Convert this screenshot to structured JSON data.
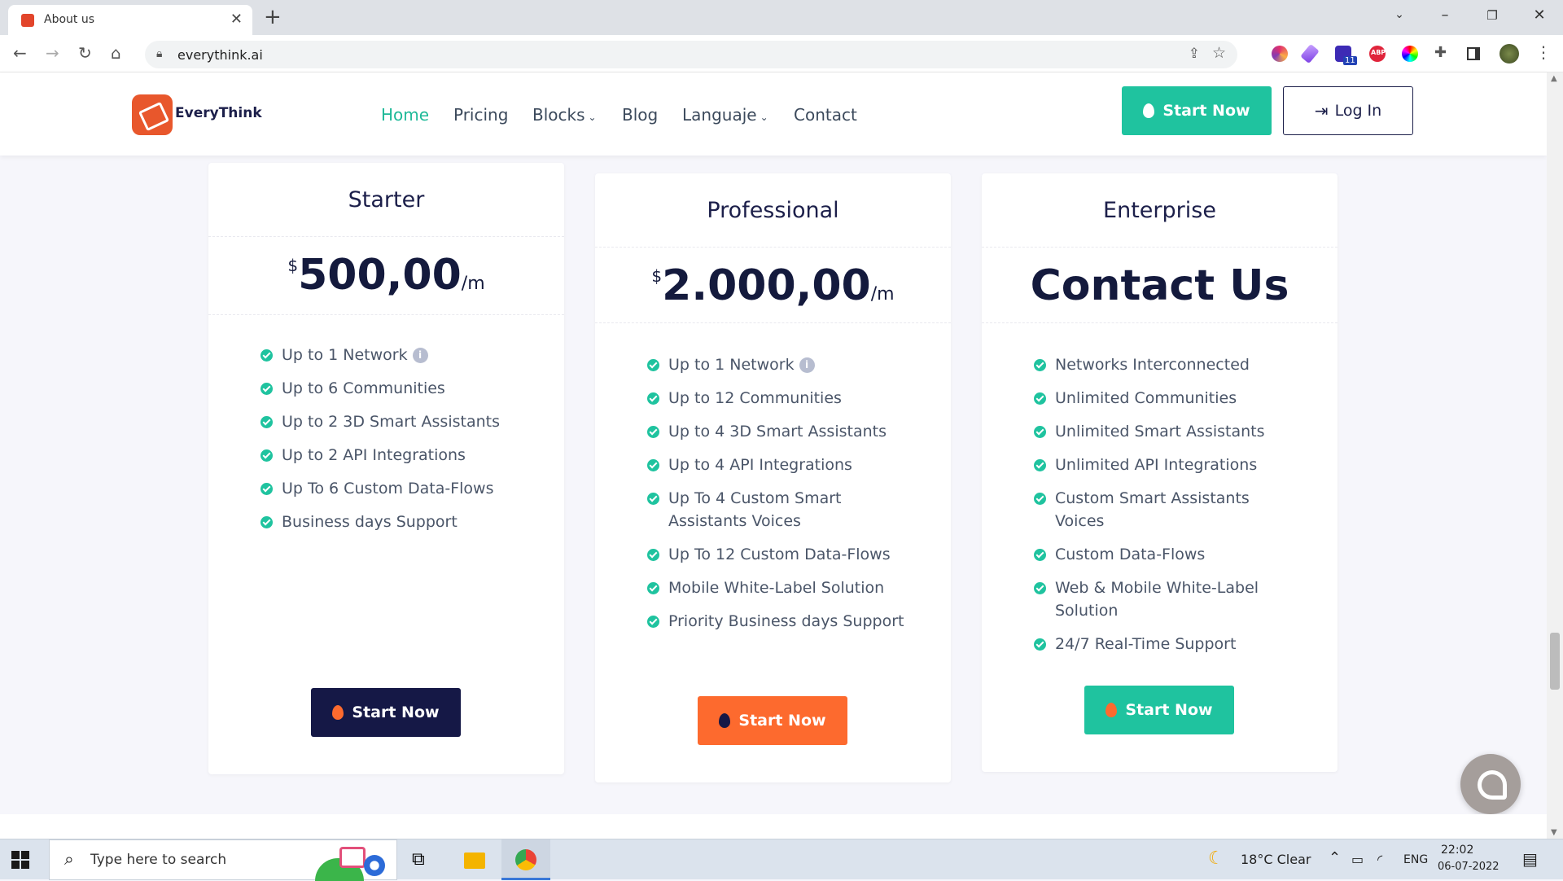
{
  "browser": {
    "tab_title": "About us",
    "url": "everythink.ai",
    "extension_badge": "11",
    "abp_label": "ABP"
  },
  "site": {
    "brand": "EveryThink",
    "nav": [
      {
        "label": "Home",
        "active": true
      },
      {
        "label": "Pricing"
      },
      {
        "label": "Blocks",
        "dropdown": true
      },
      {
        "label": "Blog"
      },
      {
        "label": "Languaje",
        "dropdown": true
      },
      {
        "label": "Contact"
      }
    ],
    "start_now": "Start Now",
    "log_in": "Log In",
    "accent_color": "#1fc39f"
  },
  "plans": [
    {
      "name": "Starter",
      "currency": "$",
      "price": "500,00",
      "period": "/m",
      "features": [
        "Up to 1 Network",
        "Up to 6 Communities",
        "Up to 2 3D Smart Assistants",
        "Up to 2 API Integrations",
        "Up To 6 Custom Data-Flows",
        "Business days Support"
      ],
      "button": "Start Now",
      "button_color": "#151846"
    },
    {
      "name": "Professional",
      "currency": "$",
      "price": "2.000,00",
      "period": "/m",
      "features": [
        "Up to 1 Network",
        "Up to 12 Communities",
        "Up to 4 3D Smart Assistants",
        "Up to 4 API Integrations",
        "Up To 4 Custom Smart Assistants Voices",
        "Up To 12 Custom Data-Flows",
        "Mobile White-Label Solution",
        "Priority Business days Support"
      ],
      "button": "Start Now",
      "button_color": "#fd6a2e"
    },
    {
      "name": "Enterprise",
      "price_text": "Contact Us",
      "features": [
        "Networks Interconnected",
        "Unlimited Communities",
        "Unlimited Smart Assistants",
        "Unlimited API Integrations",
        "Custom Smart Assistants Voices",
        "Custom Data-Flows",
        "Web & Mobile White-Label Solution",
        "24/7 Real-Time Support"
      ],
      "button": "Start Now",
      "button_color": "#1fc39f"
    }
  ],
  "info_icon": "i",
  "taskbar": {
    "search_placeholder": "Type here to search",
    "weather": "18°C  Clear",
    "language": "ENG",
    "time": "22:02",
    "date": "06-07-2022"
  }
}
